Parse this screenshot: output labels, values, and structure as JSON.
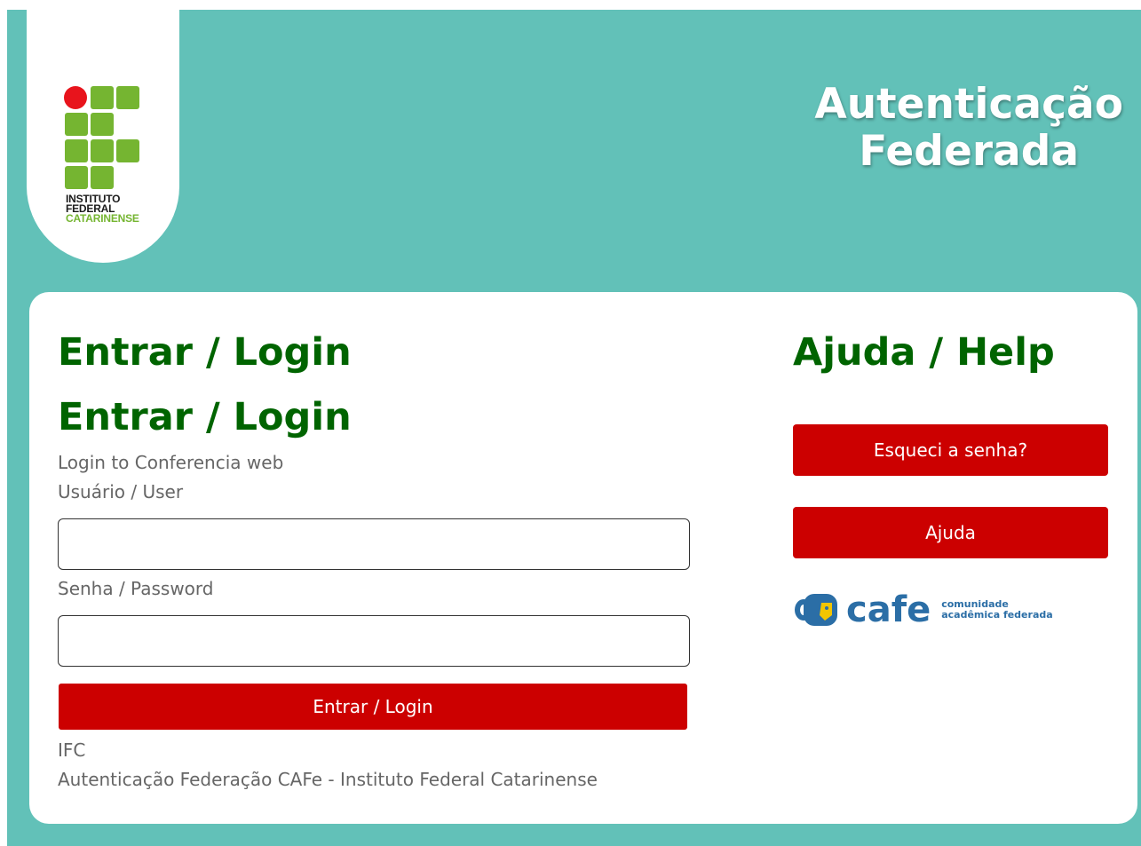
{
  "header": {
    "logo": {
      "line1": "INSTITUTO",
      "line2": "FEDERAL",
      "line3": "CATARINENSE"
    },
    "title_line1": "Autenticação",
    "title_line2": "Federada"
  },
  "login": {
    "heading_1": "Entrar / Login",
    "heading_2": "Entrar / Login",
    "intro": "Login to Conferencia web",
    "user_label": "Usuário / User",
    "user_value": "",
    "password_label": "Senha / Password",
    "password_value": "",
    "submit_label": "Entrar / Login",
    "footer_org": "IFC",
    "footer_text": "Autenticação Federação CAFe - Instituto Federal Catarinense"
  },
  "help": {
    "heading": "Ajuda / Help",
    "forgot_label": "Esqueci a senha?",
    "help_label": "Ajuda",
    "cafe_word": "cafe",
    "cafe_tag_line1": "comunidade",
    "cafe_tag_line2": "acadêmica federada"
  },
  "colors": {
    "background": "#62c1b8",
    "heading_green": "#006400",
    "button_red": "#cc0000",
    "logo_red": "#e8141c",
    "logo_green": "#75b531"
  }
}
